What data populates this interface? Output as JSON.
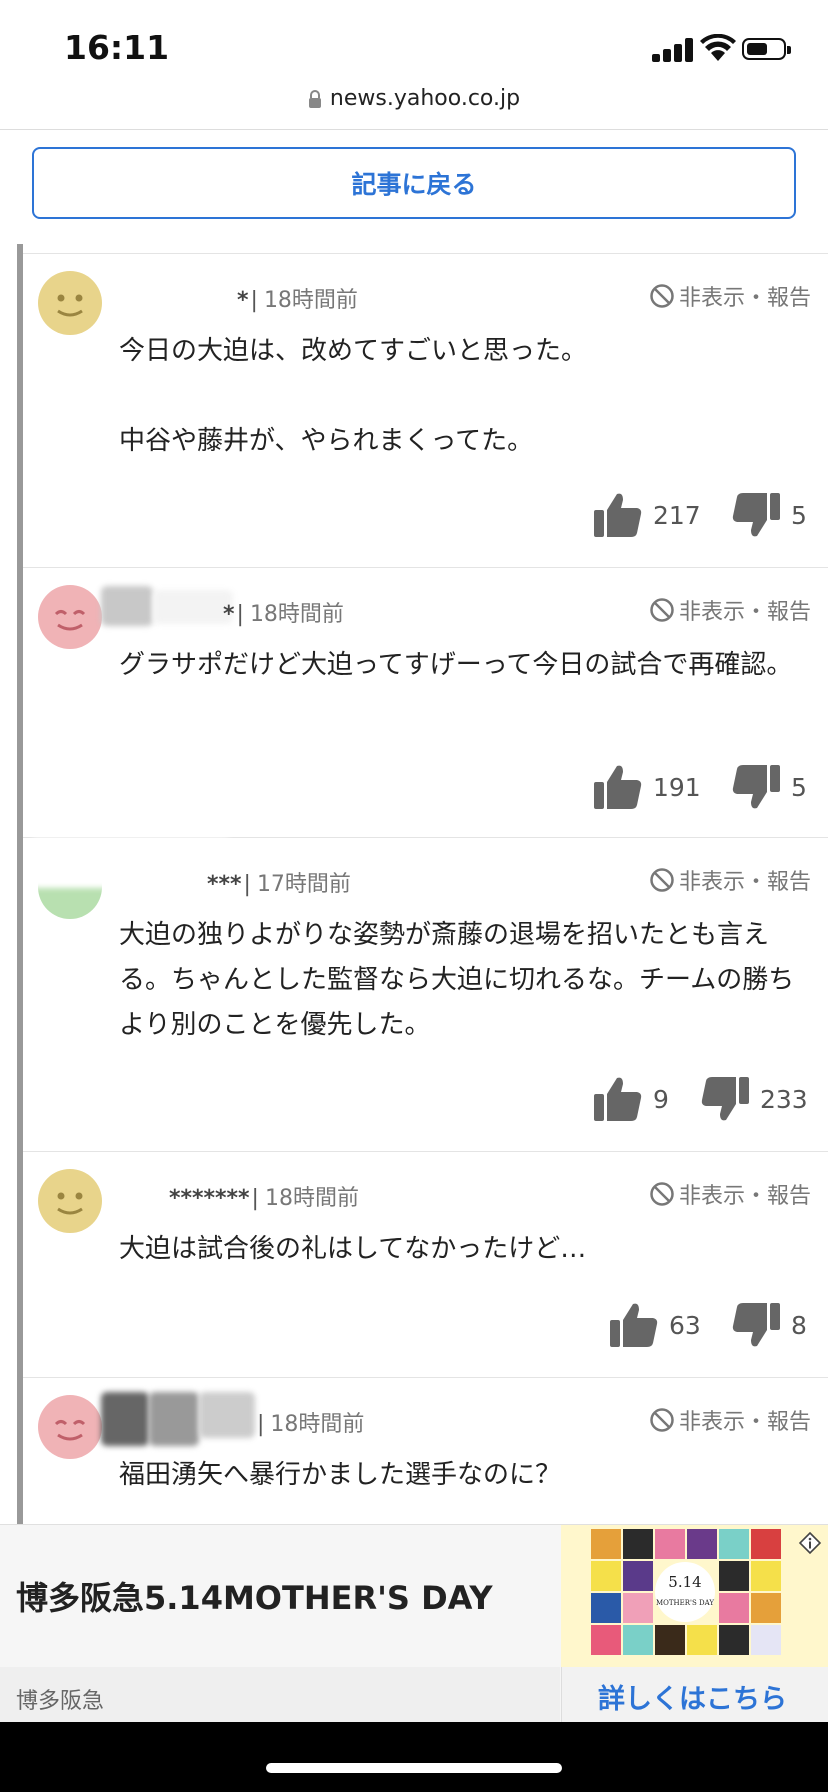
{
  "status": {
    "time": "16:11"
  },
  "browser": {
    "url": "news.yahoo.co.jp"
  },
  "back_button": "記事に戻る",
  "hide_report_label": "非表示・報告",
  "comments": [
    {
      "name": "*",
      "time": "18時間前",
      "text": "今日の大迫は、改めてすごいと思った。\n\n中谷や藤井が、やられまくってた。",
      "likes": "217",
      "dislikes": "5",
      "avatar_color": "#e8d48b"
    },
    {
      "name": "*",
      "time": "18時間前",
      "text": "グラサポだけど大迫ってすげーって今日の試合で再確認。",
      "likes": "191",
      "dislikes": "5",
      "avatar_color": "#f0b3b6"
    },
    {
      "name": "***",
      "time": "17時間前",
      "text": "大迫の独りよがりな姿勢が斎藤の退場を招いたとも言える。ちゃんとした監督なら大迫に切れるな。チームの勝ちより別のことを優先した。",
      "likes": "9",
      "dislikes": "233",
      "avatar_color": "#b8e0b0"
    },
    {
      "name": "*******",
      "time": "18時間前",
      "text": "大迫は試合後の礼はしてなかったけど…",
      "likes": "63",
      "dislikes": "8",
      "avatar_color": "#e8d48b"
    },
    {
      "name": "",
      "time": "18時間前",
      "text": "福田湧矢へ暴行かました選手なのに？",
      "likes": "",
      "dislikes": "",
      "avatar_color": "#f0b3b6"
    }
  ],
  "ad": {
    "title": "博多阪急5.14MOTHER'S DAY",
    "sponsor": "博多阪急",
    "cta": "詳しくはこちら",
    "image_text_1": "5.14",
    "image_text_2": "MOTHER'S DAY"
  },
  "colors": {
    "accent": "#2d74d6",
    "icon_gray": "#666666"
  }
}
